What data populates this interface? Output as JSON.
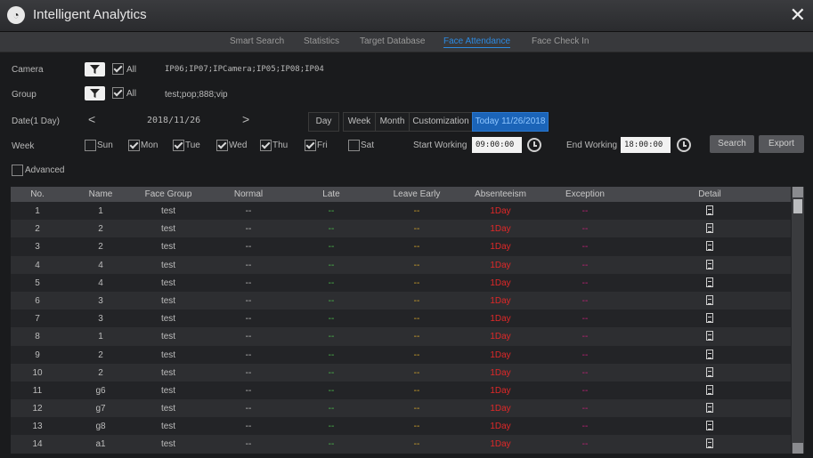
{
  "app": {
    "title": "Intelligent Analytics",
    "close": "✕"
  },
  "tabs": [
    {
      "label": "Smart Search"
    },
    {
      "label": "Statistics"
    },
    {
      "label": "Target Database"
    },
    {
      "label": "Face Attendance",
      "active": true
    },
    {
      "label": "Face Check In"
    }
  ],
  "filters": {
    "camera_label": "Camera",
    "camera_all": "All",
    "camera_value": "IP06;IP07;IPCamera;IP05;IP08;IP04",
    "group_label": "Group",
    "group_all": "All",
    "group_value": "test;pop;888;vip",
    "date_label": "Date(1 Day)",
    "date_value": "2018/11/26",
    "prev": "<",
    "next": ">",
    "range_buttons": [
      "Day",
      "Week",
      "Month",
      "Customization",
      "Today 11/26/2018"
    ],
    "week_label": "Week",
    "days": [
      {
        "label": "Sun",
        "checked": false
      },
      {
        "label": "Mon",
        "checked": true
      },
      {
        "label": "Tue",
        "checked": true
      },
      {
        "label": "Wed",
        "checked": true
      },
      {
        "label": "Thu",
        "checked": true
      },
      {
        "label": "Fri",
        "checked": true
      },
      {
        "label": "Sat",
        "checked": false
      }
    ],
    "start_label": "Start Working",
    "start_value": "09:00:00",
    "end_label": "End Working",
    "end_value": "18:00:00",
    "search_label": "Search",
    "export_label": "Export",
    "advanced_label": "Advanced"
  },
  "table": {
    "headers": [
      "No.",
      "Name",
      "Face Group",
      "Normal",
      "Late",
      "Leave Early",
      "Absenteeism",
      "Exception",
      "Detail"
    ],
    "rows": [
      [
        "1",
        "1",
        "test",
        "--",
        "--",
        "--",
        "1Day",
        "--"
      ],
      [
        "2",
        "2",
        "test",
        "--",
        "--",
        "--",
        "1Day",
        "--"
      ],
      [
        "3",
        "2",
        "test",
        "--",
        "--",
        "--",
        "1Day",
        "--"
      ],
      [
        "4",
        "4",
        "test",
        "--",
        "--",
        "--",
        "1Day",
        "--"
      ],
      [
        "5",
        "4",
        "test",
        "--",
        "--",
        "--",
        "1Day",
        "--"
      ],
      [
        "6",
        "3",
        "test",
        "--",
        "--",
        "--",
        "1Day",
        "--"
      ],
      [
        "7",
        "3",
        "test",
        "--",
        "--",
        "--",
        "1Day",
        "--"
      ],
      [
        "8",
        "1",
        "test",
        "--",
        "--",
        "--",
        "1Day",
        "--"
      ],
      [
        "9",
        "2",
        "test",
        "--",
        "--",
        "--",
        "1Day",
        "--"
      ],
      [
        "10",
        "2",
        "test",
        "--",
        "--",
        "--",
        "1Day",
        "--"
      ],
      [
        "11",
        "g6",
        "test",
        "--",
        "--",
        "--",
        "1Day",
        "--"
      ],
      [
        "12",
        "g7",
        "test",
        "--",
        "--",
        "--",
        "1Day",
        "--"
      ],
      [
        "13",
        "g8",
        "test",
        "--",
        "--",
        "--",
        "1Day",
        "--"
      ],
      [
        "14",
        "a1",
        "test",
        "--",
        "--",
        "--",
        "1Day",
        "--"
      ]
    ]
  },
  "colors": {
    "accent": "#2d8ae0",
    "late": "#4cc14c",
    "leave_early": "#d9a82a",
    "absent": "#e02828",
    "exception": "#c8207a"
  }
}
